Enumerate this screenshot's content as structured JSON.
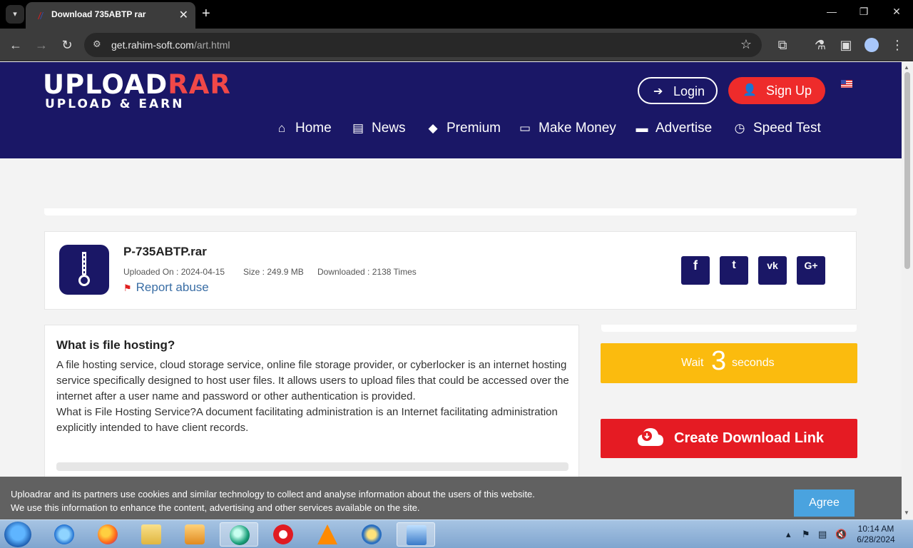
{
  "browser": {
    "tab_title": "Download 735ABTP rar",
    "url_host": "get.rahim-soft.com",
    "url_path": "/art.html"
  },
  "site": {
    "logo_top": "UPLOAD",
    "logo_top_accent": "RAR",
    "logo_bottom": "UPLOAD & EARN",
    "login_label": "Login",
    "signup_label": "Sign Up",
    "nav": [
      "Home",
      "News",
      "Premium",
      "Make Money",
      "Advertise",
      "Speed Test"
    ]
  },
  "file": {
    "name": "P-735ABTP.rar",
    "uploaded": "Uploaded On : 2024-04-15",
    "size": "Size : 249.9 MB",
    "downloads": "Downloaded : 2138 Times",
    "report": "Report abuse"
  },
  "social": [
    "f",
    "t",
    "vk",
    "G+"
  ],
  "article": {
    "title": "What is file hosting?",
    "para1": "A file hosting service, cloud storage service, online file storage provider, or cyberlocker is an internet hosting service specifically designed to host user files. It allows users to upload files that could be accessed over the internet after a user name and password or other authentication is provided.",
    "para2": "What is File Hosting Service?A document facilitating administration is an Internet facilitating administration explicitly intended to have client records."
  },
  "wait": {
    "before": "Wait",
    "count": "3",
    "after": "seconds"
  },
  "download_button": "Create Download Link",
  "cookie": {
    "line1": "Uploadrar and its partners use cookies and similar technology to collect and analyse information about the users of this website.",
    "line2": "We use this information to enhance the content, advertising and other services available on the site.",
    "agree": "Agree"
  },
  "taskbar": {
    "time": "10:14 AM",
    "date": "6/28/2024"
  },
  "colors": {
    "header_bg": "#1a1766",
    "accent_red": "#e51b23",
    "wait_yellow": "#fbbb0e",
    "agree_blue": "#4aa3df"
  }
}
